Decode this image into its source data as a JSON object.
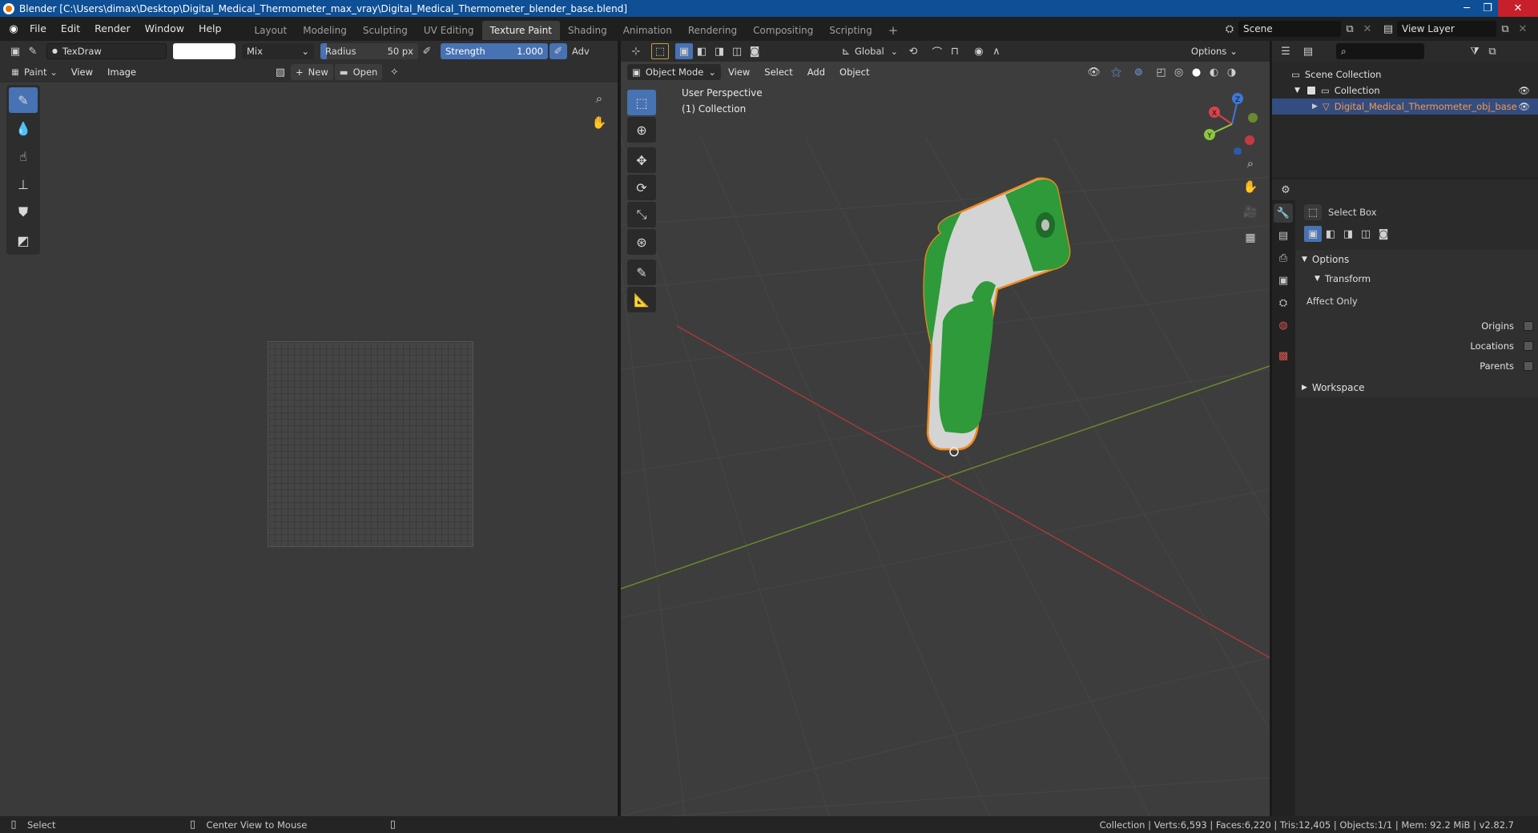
{
  "window": {
    "title": "Blender [C:\\Users\\dimax\\Desktop\\Digital_Medical_Thermometer_max_vray\\Digital_Medical_Thermometer_blender_base.blend]",
    "minimize": "─",
    "maximize": "❐",
    "close": "✕"
  },
  "menu": {
    "items": [
      "File",
      "Edit",
      "Render",
      "Window",
      "Help"
    ]
  },
  "workspaces": {
    "tabs": [
      "Layout",
      "Modeling",
      "Sculpting",
      "UV Editing",
      "Texture Paint",
      "Shading",
      "Animation",
      "Rendering",
      "Compositing",
      "Scripting"
    ],
    "active": "Texture Paint",
    "add": "+"
  },
  "scene": {
    "name": "Scene",
    "view_layer": "View Layer"
  },
  "image_editor": {
    "brush_name": "TexDraw",
    "blend_mode": "Mix",
    "radius_label": "Radius",
    "radius_value": "50 px",
    "strength_label": "Strength",
    "strength_value": "1.000",
    "adv": "Adv",
    "mode": "Paint",
    "menus": [
      "View",
      "Image"
    ],
    "new_label": "New",
    "open_label": "Open"
  },
  "viewport": {
    "orientation": "Global",
    "options_label": "Options",
    "mode": "Object Mode",
    "menus": [
      "View",
      "Select",
      "Add",
      "Object"
    ],
    "perspective_label": "User Perspective",
    "collection_label": "(1) Collection",
    "gizmo": {
      "x": "X",
      "y": "Y",
      "z": "Z"
    }
  },
  "outliner": {
    "root": "Scene Collection",
    "collection": "Collection",
    "object": "Digital_Medical_Thermometer_obj_base"
  },
  "properties": {
    "tool_name": "Select Box",
    "options_header": "Options",
    "transform_header": "Transform",
    "affect_only": "Affect Only",
    "rows": [
      "Origins",
      "Locations",
      "Parents"
    ],
    "workspace_header": "Workspace"
  },
  "statusbar": {
    "left_action": "Select",
    "middle_action": "Center View to Mouse",
    "stats": "Collection | Verts:6,593 | Faces:6,220 | Tris:12,405 | Objects:1/1 | Mem: 92.2 MiB | v2.82.7"
  },
  "colors": {
    "accent_blue": "#4772b3",
    "selection_orange": "#f59a4c",
    "thermometer_green": "#2e9a3a",
    "thermometer_white": "#d9d9d9"
  }
}
